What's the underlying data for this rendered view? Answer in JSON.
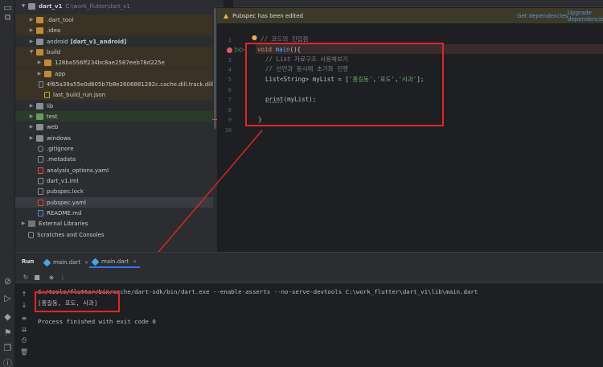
{
  "project": {
    "root_name": "dart_v1",
    "root_path": "C:\\work_flutter\\dart_v1",
    "items": [
      {
        "label": "dart_v1",
        "extra": "C:\\work_flutter\\dart_v1"
      },
      {
        "label": ".dart_tool"
      },
      {
        "label": ".idea"
      },
      {
        "label": "android",
        "extra": "[dart_v1_android]"
      },
      {
        "label": "build"
      },
      {
        "label": "128ba556ff234bc8ae2587eeb78d225e"
      },
      {
        "label": "app"
      },
      {
        "label": "4f65a39a55e0d605b7b8e2606881282c.cache.dill.track.dill"
      },
      {
        "label": "last_build_run.json"
      },
      {
        "label": "lib"
      },
      {
        "label": "test"
      },
      {
        "label": "web"
      },
      {
        "label": "windows"
      },
      {
        "label": ".gitignore"
      },
      {
        "label": ".metadata"
      },
      {
        "label": "analysis_options.yaml"
      },
      {
        "label": "dart_v1.iml"
      },
      {
        "label": "pubspec.lock"
      },
      {
        "label": "pubspec.yaml"
      },
      {
        "label": "README.md"
      },
      {
        "label": "External Libraries"
      },
      {
        "label": "Scratches and Consoles"
      }
    ]
  },
  "editor": {
    "banner_text": "Pubspec has been edited",
    "banner_link_get": "Get dependencies",
    "banner_link_upgrade": "Upgrade dependencies",
    "line_numbers": [
      "1",
      "2",
      "3",
      "4",
      "5",
      "6",
      "7",
      "8",
      "9",
      "10"
    ],
    "code": {
      "l2_comment": "// 코드의 진입점",
      "l3_kw": "void",
      "l3_fn": "main",
      "l3_rest": "(){",
      "l4_comment": "// List 자료구조 사용해보기",
      "l5_comment": "// 선언과 동시에 초기화 진행",
      "l6_type": "List<String> myList = [",
      "l6_s1": "'홍길동'",
      "l6_c1": ",",
      "l6_s2": "'포도'",
      "l6_c2": ",",
      "l6_s3": "'사과'",
      "l6_end": "];",
      "l8_fn": "print",
      "l8_rest": "(myList);",
      "l10": "}"
    }
  },
  "run": {
    "label": "Run",
    "tabs": [
      {
        "label": "main.dart"
      },
      {
        "label": "main.dart"
      }
    ],
    "command": "C:/tools/flutter/bin/cache/dart-sdk/bin/dart.exe --enable-asserts --no-serve-devtools C:\\work_flutter\\dart_v1\\lib\\main.dart",
    "output": "[홍길동, 포도, 사과]",
    "exit": "Process finished with exit code 0"
  },
  "colors": {
    "highlight_box": "#e0262a",
    "keyword": "#cf8e6d",
    "function": "#56a8f5",
    "string": "#6aab73",
    "comment": "#7a7e85"
  }
}
